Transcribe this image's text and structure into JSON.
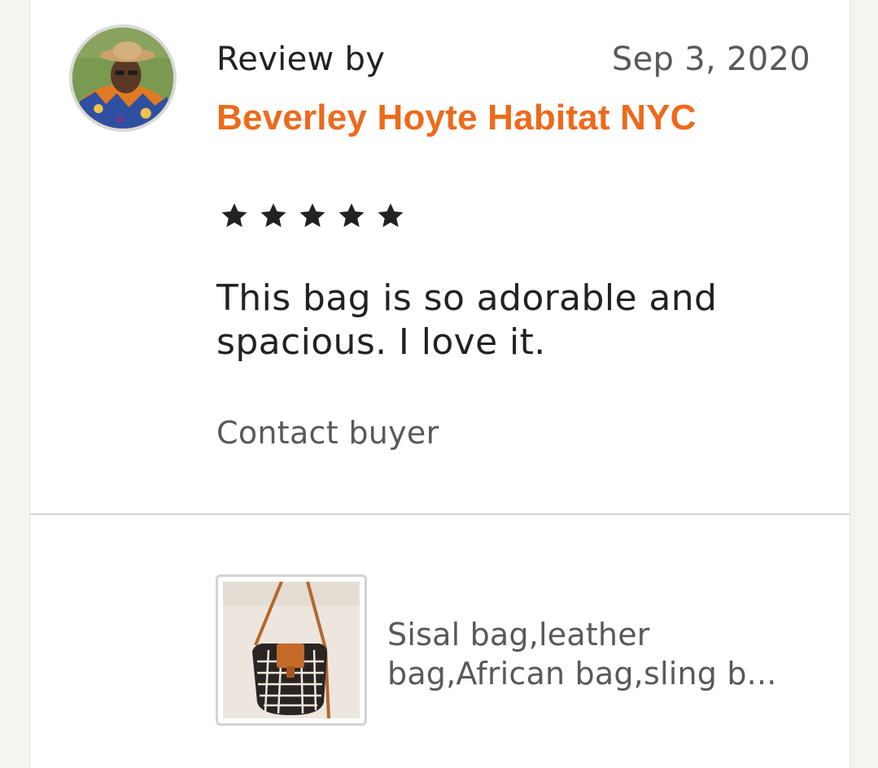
{
  "review": {
    "label": "Review by",
    "date": "Sep 3, 2020",
    "reviewer_name": "Beverley Hoyte Habitat NYC",
    "rating": 5,
    "rating_max": 5,
    "text": "This bag is so adorable and spacious. I love it.",
    "contact_label": "Contact buyer"
  },
  "listing": {
    "title": "Sisal bag,leather bag,African bag,sling b..."
  },
  "colors": {
    "accent": "#ee6a1b",
    "text_primary": "#222222",
    "text_secondary": "#595959",
    "divider": "#d6d6d6"
  },
  "icons": {
    "star": "star-icon",
    "avatar": "reviewer-avatar",
    "thumbnail": "listing-thumbnail"
  }
}
